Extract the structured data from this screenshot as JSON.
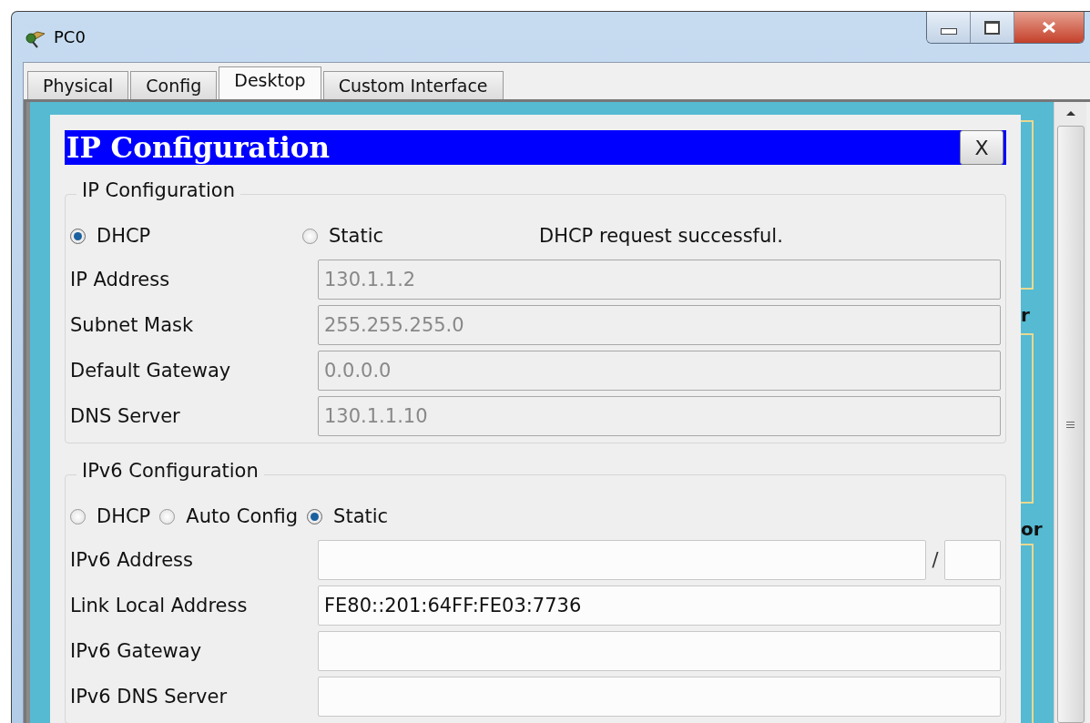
{
  "window": {
    "title": "PC0"
  },
  "tabs": [
    {
      "label": "Physical",
      "selected": false
    },
    {
      "label": "Config",
      "selected": false
    },
    {
      "label": "Desktop",
      "selected": true
    },
    {
      "label": "Custom Interface",
      "selected": false
    }
  ],
  "dialog": {
    "title": "IP Configuration",
    "close": "X"
  },
  "ipv4": {
    "legend": "IP Configuration",
    "modes": [
      {
        "label": "DHCP",
        "selected": true
      },
      {
        "label": "Static",
        "selected": false
      }
    ],
    "status": "DHCP request successful.",
    "fields": [
      {
        "label": "IP Address",
        "value": "130.1.1.2",
        "disabled": true
      },
      {
        "label": "Subnet Mask",
        "value": "255.255.255.0",
        "disabled": true
      },
      {
        "label": "Default Gateway",
        "value": "0.0.0.0",
        "disabled": true
      },
      {
        "label": "DNS Server",
        "value": "130.1.1.10",
        "disabled": true
      }
    ]
  },
  "ipv6": {
    "legend": "IPv6 Configuration",
    "modes": [
      {
        "label": "DHCP",
        "selected": false
      },
      {
        "label": "Auto Config",
        "selected": false
      },
      {
        "label": "Static",
        "selected": true
      }
    ],
    "fields": [
      {
        "label": "IPv6 Address",
        "disabled": false,
        "prefix": {
          "separator": "/"
        }
      },
      {
        "label": "Link Local Address",
        "value": "FE80::201:64FF:FE03:7736",
        "disabled": false
      },
      {
        "label": "IPv6 Gateway",
        "disabled": false
      },
      {
        "label": "IPv6 DNS Server",
        "disabled": false
      }
    ]
  },
  "background_fragments": [
    "r",
    "or"
  ]
}
